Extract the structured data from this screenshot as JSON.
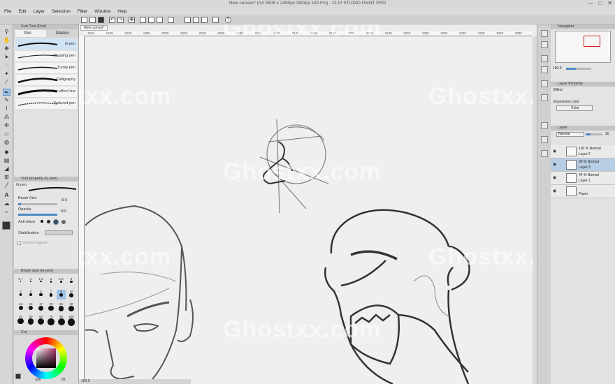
{
  "app": {
    "title": "New canvas* (A4 3508 x 2480px 300dpi 100.0%) - CLIP STUDIO PAINT PRO"
  },
  "window_controls": [
    "—",
    "□",
    "✕"
  ],
  "menu": [
    "File",
    "Edit",
    "Layer",
    "Selection",
    "Filter",
    "Window",
    "Help"
  ],
  "document_tab": "New canvas*",
  "ruler_ticks": [
    "1920",
    "1940",
    "1960",
    "1980",
    "2000",
    "2020",
    "2040",
    "2060",
    "2080",
    "2100",
    "2120",
    "2140",
    "2160",
    "2180",
    "2200",
    "2220",
    "2240",
    "2260",
    "2280",
    "2300",
    "2320",
    "2340",
    "2360",
    "2380"
  ],
  "subtool": {
    "panel_title": "Sub Tool (Pen)",
    "tabs": [
      "Pen",
      "Marker"
    ],
    "brushes": [
      "G-pen",
      "Mapping pen",
      "Turnip pen",
      "Calligraphy",
      "For effect line",
      "Textured pen"
    ]
  },
  "tool_property": {
    "panel_title": "Tool property (G-pen)",
    "brush_name": "G-pen",
    "brush_size_label": "Brush Size",
    "brush_size_value": "8.0",
    "opacity_label": "Opacity",
    "opacity_value": "100",
    "anti_alias_label": "Anti-aliasi",
    "stabilization_label": "Stabilization",
    "vector_magnet_label": "Vector magnet",
    "brush_size_fraction": 0.08,
    "opacity_fraction": 1.0
  },
  "brush_size_panel": {
    "panel_title": "Brush size (G-pen)",
    "sizes": [
      "0.7",
      "1",
      "1.5",
      "2",
      "2.5",
      "3",
      "4",
      "5",
      "6",
      "7",
      "8",
      "10",
      "12",
      "15",
      "17",
      "20",
      "25",
      "30",
      "40",
      "50",
      "60",
      "70",
      "80",
      "100"
    ]
  },
  "color_panel": {
    "title": "Col",
    "readout": "336",
    "readout_2": "26"
  },
  "navigator": {
    "title": "Navigator",
    "zoom": "100.0"
  },
  "layer_property": {
    "title": "Layer Property",
    "effect_label": "Effect",
    "expression_color_label": "Expression color",
    "expression_color_value": "Color"
  },
  "layer_panel": {
    "title": "Layer",
    "blend_mode": "Normal",
    "opacity": "30",
    "layers": [
      {
        "opacity": "100 %",
        "mode": "Normal",
        "name": "Layer 2",
        "selected": false
      },
      {
        "opacity": "30 %",
        "mode": "Normal",
        "name": "Layer 3",
        "selected": true
      },
      {
        "opacity": "44 %",
        "mode": "Normal",
        "name": "Layer 1",
        "selected": false
      },
      {
        "opacity": "",
        "mode": "",
        "name": "Paper",
        "selected": false
      }
    ]
  },
  "status": {
    "zoom": "100.0"
  },
  "watermark": "Ghostxx.com",
  "colors": {
    "accent": "#4d88c4",
    "selection": "#b7cde3",
    "canvas": "#efefef"
  }
}
